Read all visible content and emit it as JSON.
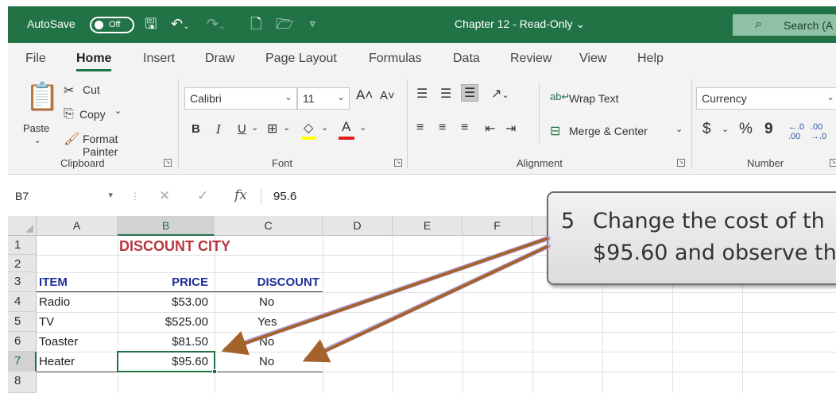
{
  "titlebar": {
    "autosave_label": "AutoSave",
    "autosave_state": "Off",
    "doc_title": "Chapter 12  -  Read-Only",
    "search_text": "Search (A"
  },
  "ribbon_tabs": [
    "File",
    "Home",
    "Insert",
    "Draw",
    "Page Layout",
    "Formulas",
    "Data",
    "Review",
    "View",
    "Help"
  ],
  "ribbon": {
    "clipboard": {
      "paste": "Paste",
      "cut": "Cut",
      "copy": "Copy",
      "format_painter": "Format Painter",
      "group": "Clipboard"
    },
    "font": {
      "name": "Calibri",
      "size": "11",
      "bold": "B",
      "italic": "I",
      "underline": "U",
      "group": "Font"
    },
    "alignment": {
      "wrap_text": "Wrap Text",
      "merge_center": "Merge & Center",
      "group": "Alignment"
    },
    "number": {
      "format": "Currency",
      "currency": "$",
      "percent": "%",
      "comma": "9",
      "group": "Number"
    }
  },
  "formula_bar": {
    "name_box": "B7",
    "fx": "fx",
    "value": "95.6"
  },
  "columns": [
    "A",
    "B",
    "C",
    "D",
    "E",
    "F"
  ],
  "rows": [
    "1",
    "2",
    "3",
    "4",
    "5",
    "6",
    "7",
    "8"
  ],
  "sheet": {
    "title": "DISCOUNT CITY",
    "headers": {
      "item": "ITEM",
      "price": "PRICE",
      "discount": "DISCOUNT"
    },
    "data": [
      {
        "item": "Radio",
        "price": "$53.00",
        "discount": "No"
      },
      {
        "item": "TV",
        "price": "$525.00",
        "discount": "Yes"
      },
      {
        "item": "Toaster",
        "price": "$81.50",
        "discount": "No"
      },
      {
        "item": "Heater",
        "price": "$95.60",
        "discount": "No"
      }
    ]
  },
  "callout": {
    "number": "5",
    "line1": "Change the cost of th",
    "line2": "$95.60 and observe th"
  },
  "colors": {
    "excel_green": "#217346",
    "title_red": "#b7373e",
    "header_blue": "#1f2f9b",
    "arrow": "#a5632c"
  }
}
